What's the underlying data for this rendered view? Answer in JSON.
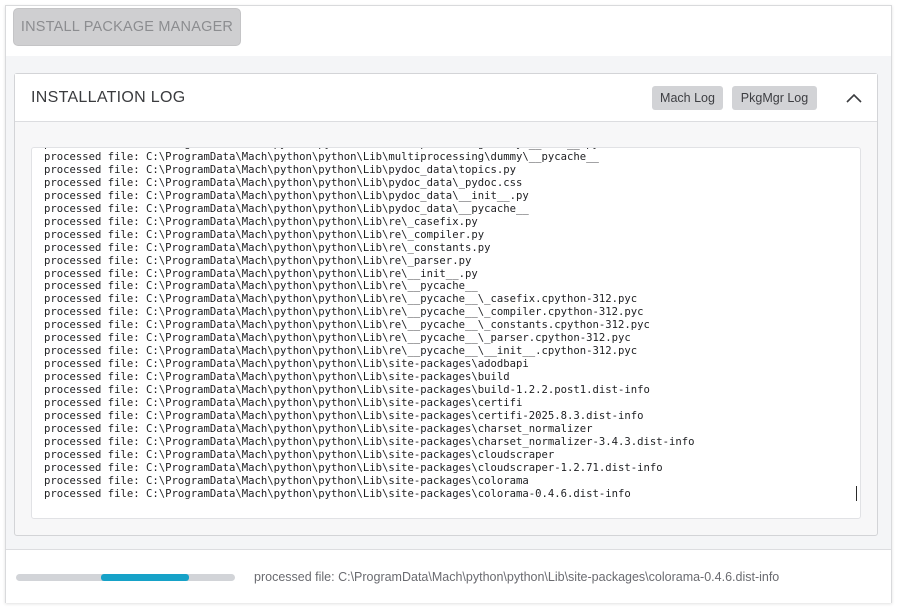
{
  "toolbar": {
    "install_label": "INSTALL PACKAGE MANAGER"
  },
  "log_panel": {
    "title": "INSTALLATION LOG",
    "mach_log_label": "Mach Log",
    "pkgmgr_log_label": "PkgMgr Log",
    "collapse_icon": "chevron-up-icon",
    "lines": [
      "processed file: C:\\ProgramData\\Mach\\python\\python\\Lib\\multiprocessing\\dummy\\__init__.py",
      "processed file: C:\\ProgramData\\Mach\\python\\python\\Lib\\multiprocessing\\dummy\\__pycache__",
      "processed file: C:\\ProgramData\\Mach\\python\\python\\Lib\\pydoc_data\\topics.py",
      "processed file: C:\\ProgramData\\Mach\\python\\python\\Lib\\pydoc_data\\_pydoc.css",
      "processed file: C:\\ProgramData\\Mach\\python\\python\\Lib\\pydoc_data\\__init__.py",
      "processed file: C:\\ProgramData\\Mach\\python\\python\\Lib\\pydoc_data\\__pycache__",
      "processed file: C:\\ProgramData\\Mach\\python\\python\\Lib\\re\\_casefix.py",
      "processed file: C:\\ProgramData\\Mach\\python\\python\\Lib\\re\\_compiler.py",
      "processed file: C:\\ProgramData\\Mach\\python\\python\\Lib\\re\\_constants.py",
      "processed file: C:\\ProgramData\\Mach\\python\\python\\Lib\\re\\_parser.py",
      "processed file: C:\\ProgramData\\Mach\\python\\python\\Lib\\re\\__init__.py",
      "processed file: C:\\ProgramData\\Mach\\python\\python\\Lib\\re\\__pycache__",
      "processed file: C:\\ProgramData\\Mach\\python\\python\\Lib\\re\\__pycache__\\_casefix.cpython-312.pyc",
      "processed file: C:\\ProgramData\\Mach\\python\\python\\Lib\\re\\__pycache__\\_compiler.cpython-312.pyc",
      "processed file: C:\\ProgramData\\Mach\\python\\python\\Lib\\re\\__pycache__\\_constants.cpython-312.pyc",
      "processed file: C:\\ProgramData\\Mach\\python\\python\\Lib\\re\\__pycache__\\_parser.cpython-312.pyc",
      "processed file: C:\\ProgramData\\Mach\\python\\python\\Lib\\re\\__pycache__\\__init__.cpython-312.pyc",
      "processed file: C:\\ProgramData\\Mach\\python\\python\\Lib\\site-packages\\adodbapi",
      "processed file: C:\\ProgramData\\Mach\\python\\python\\Lib\\site-packages\\build",
      "processed file: C:\\ProgramData\\Mach\\python\\python\\Lib\\site-packages\\build-1.2.2.post1.dist-info",
      "processed file: C:\\ProgramData\\Mach\\python\\python\\Lib\\site-packages\\certifi",
      "processed file: C:\\ProgramData\\Mach\\python\\python\\Lib\\site-packages\\certifi-2025.8.3.dist-info",
      "processed file: C:\\ProgramData\\Mach\\python\\python\\Lib\\site-packages\\charset_normalizer",
      "processed file: C:\\ProgramData\\Mach\\python\\python\\Lib\\site-packages\\charset_normalizer-3.4.3.dist-info",
      "processed file: C:\\ProgramData\\Mach\\python\\python\\Lib\\site-packages\\cloudscraper",
      "processed file: C:\\ProgramData\\Mach\\python\\python\\Lib\\site-packages\\cloudscraper-1.2.71.dist-info",
      "processed file: C:\\ProgramData\\Mach\\python\\python\\Lib\\site-packages\\colorama",
      "processed file: C:\\ProgramData\\Mach\\python\\python\\Lib\\site-packages\\colorama-0.4.6.dist-info"
    ]
  },
  "footer": {
    "progress": {
      "start": 0.39,
      "end": 0.79,
      "color": "#16a2c8"
    },
    "status_text": "processed file: C:\\ProgramData\\Mach\\python\\python\\Lib\\site-packages\\colorama-0.4.6.dist-info"
  }
}
